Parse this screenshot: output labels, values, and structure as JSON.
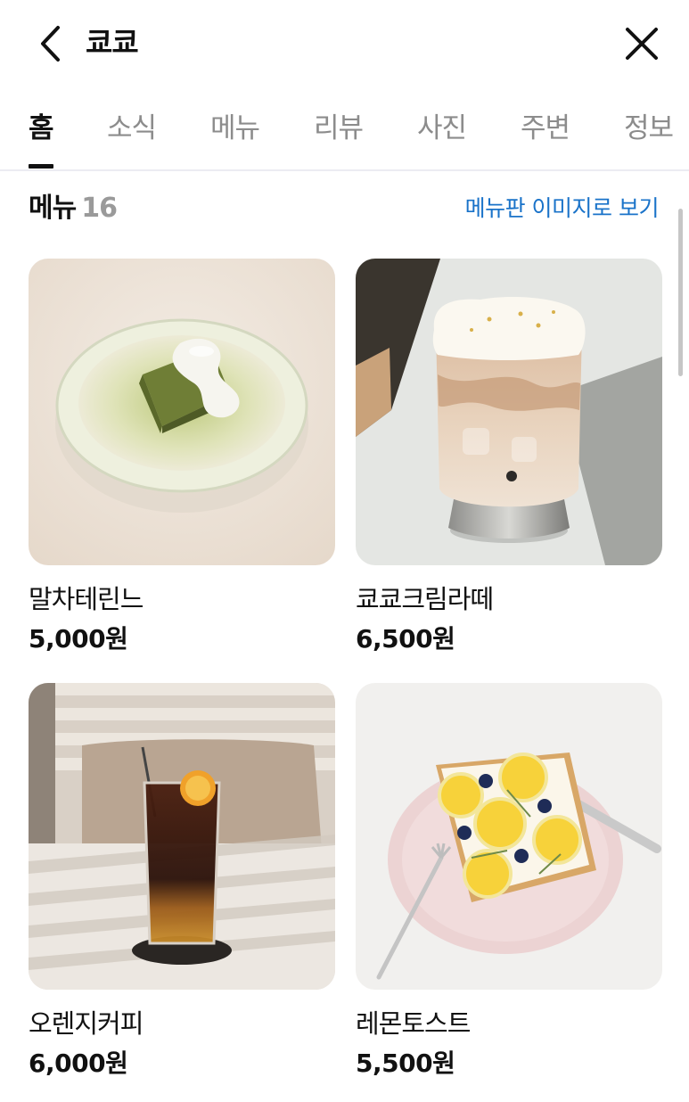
{
  "header": {
    "title": "쿄쿄",
    "back_icon": "chevron-left-icon",
    "close_icon": "close-icon"
  },
  "tabs": [
    {
      "label": "홈",
      "active": true
    },
    {
      "label": "소식",
      "active": false
    },
    {
      "label": "메뉴",
      "active": false
    },
    {
      "label": "리뷰",
      "active": false
    },
    {
      "label": "사진",
      "active": false
    },
    {
      "label": "주변",
      "active": false
    },
    {
      "label": "정보",
      "active": false
    }
  ],
  "menu_section": {
    "title": "메뉴",
    "count": "16",
    "menu_board_link": "메뉴판 이미지로 보기"
  },
  "menu_items": [
    {
      "name": "말차테린느",
      "price": "5,000원"
    },
    {
      "name": "쿄쿄크림라떼",
      "price": "6,500원"
    },
    {
      "name": "오렌지커피",
      "price": "6,000원"
    },
    {
      "name": "레몬토스트",
      "price": "5,500원"
    }
  ],
  "colors": {
    "link": "#1a73c9",
    "active_tab": "#111111",
    "inactive_tab": "#8c8c8c",
    "count": "#9a9a9a"
  }
}
